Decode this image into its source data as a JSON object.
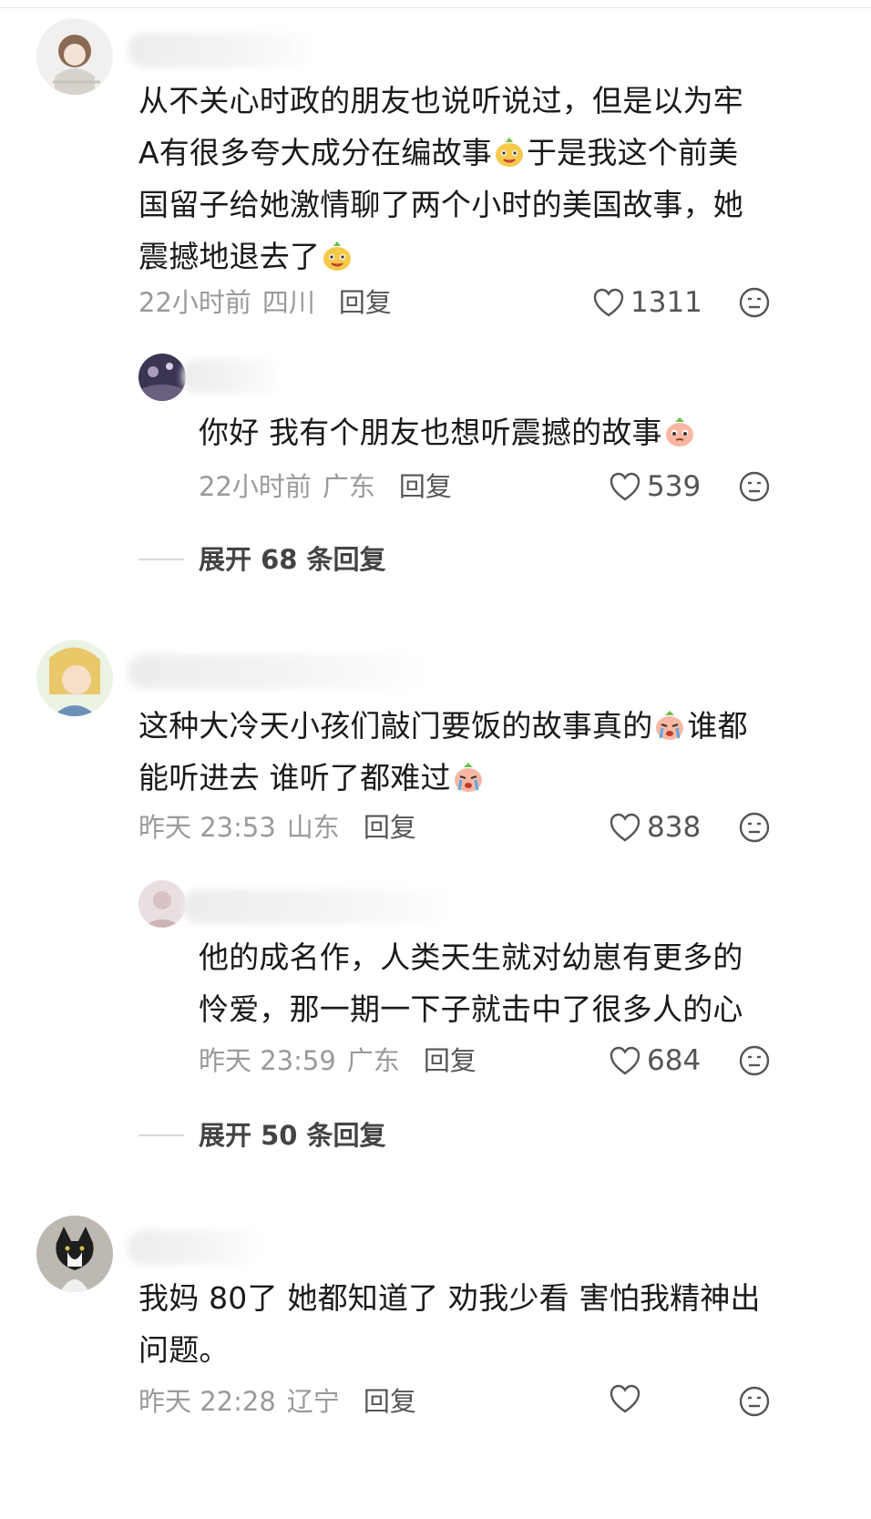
{
  "comments": [
    {
      "text_parts": [
        "从不关心时政的朋友也说听说过，但是以为牢\nA有很多夸大成分在编故事",
        "于是我这个前美\n国留子给她激情聊了两个小时的美国故事，她\n震撼地退去了",
        ""
      ],
      "emojis": [
        "grin-face-emoji",
        "grin-face-emoji"
      ],
      "time": "22小时前",
      "location": "四川",
      "reply_label": "回复",
      "likes": "1311"
    },
    {
      "text_parts": [
        "你好 我有个朋友也想听震撼的故事",
        ""
      ],
      "emojis": [
        "pleading-face-emoji"
      ],
      "time": "22小时前",
      "location": "广东",
      "reply_label": "回复",
      "likes": "539"
    },
    {
      "text_parts": [
        "这种大冷天小孩们敲门要饭的故事真的",
        "谁都\n能听进去 谁听了都难过",
        ""
      ],
      "emojis": [
        "crying-face-emoji",
        "crying-face-emoji"
      ],
      "time": "昨天 23:53",
      "location": "山东",
      "reply_label": "回复",
      "likes": "838"
    },
    {
      "text_parts": [
        "他的成名作，人类天生就对幼崽有更多的\n怜爱，那一期一下子就击中了很多人的心"
      ],
      "emojis": [],
      "time": "昨天 23:59",
      "location": "广东",
      "reply_label": "回复",
      "likes": "684"
    },
    {
      "text_parts": [
        "我妈 80了 她都知道了 劝我少看 害怕我精神出\n问题。"
      ],
      "emojis": [],
      "time": "昨天 22:28",
      "location": "辽宁",
      "reply_label": "回复",
      "likes": ""
    }
  ],
  "expanders": [
    {
      "label": "展开 68 条回复"
    },
    {
      "label": "展开 50 条回复"
    }
  ],
  "colors": {
    "meta": "#9a9a9a",
    "text": "#1a1a1a",
    "emoji_face": "#f6c94b",
    "emoji_peach": "#f7b7a3",
    "emoji_leaf": "#6cbf4b"
  }
}
